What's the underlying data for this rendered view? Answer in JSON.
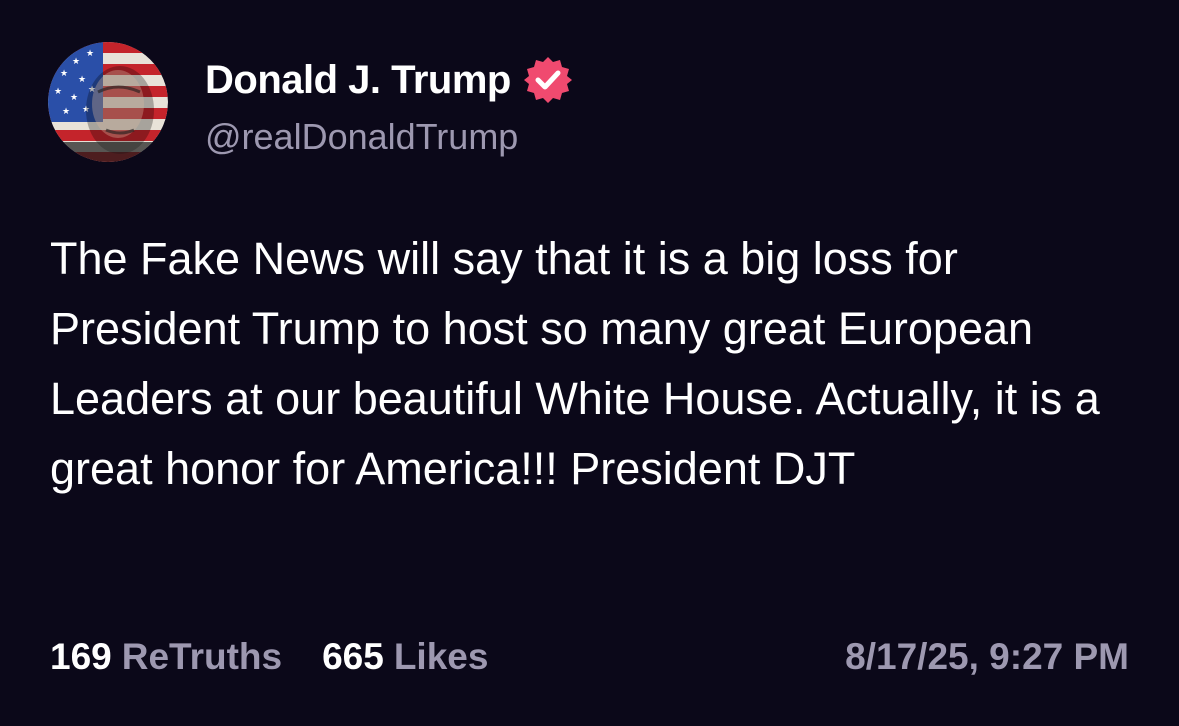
{
  "author": {
    "display_name": "Donald J. Trump",
    "handle": "@realDonaldTrump",
    "avatar": "flag-portrait-avatar",
    "verified_icon": "verified-badge-icon"
  },
  "post": {
    "text": "The Fake News will say that it is a big loss for President Trump to host so many great European Leaders at our beautiful White House. Actually, it is a great honor for America!!! President DJT"
  },
  "stats": {
    "retruths_count": "169",
    "retruths_label": "ReTruths",
    "likes_count": "665",
    "likes_label": "Likes"
  },
  "timestamp": "8/17/25, 9:27 PM",
  "colors": {
    "background": "#0b0819",
    "text": "#ffffff",
    "muted": "#9d98b0",
    "verified_badge": "#f04a6f"
  }
}
